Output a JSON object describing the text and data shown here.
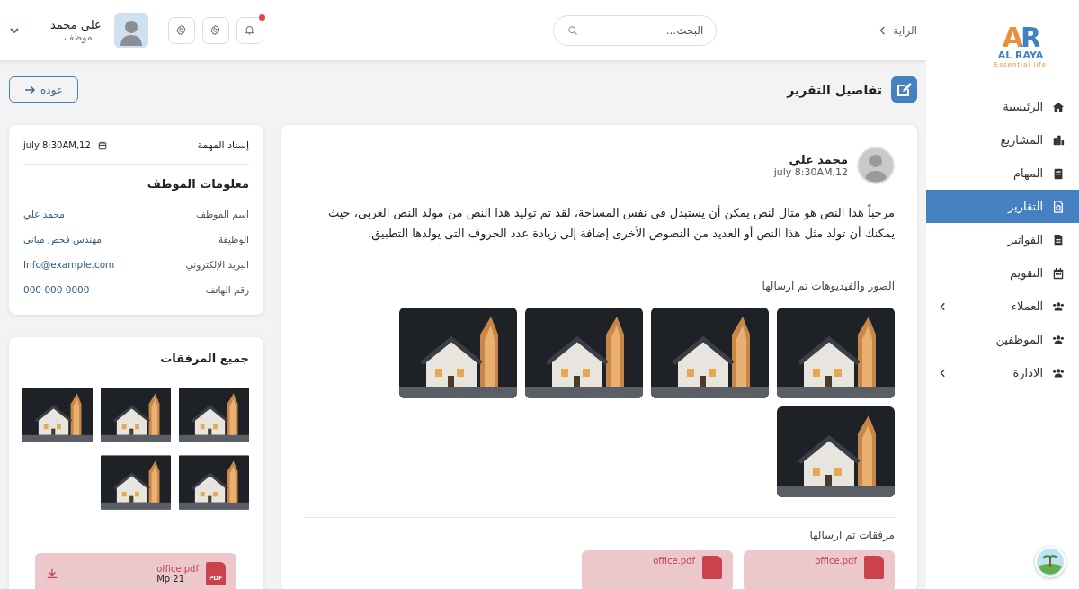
{
  "sidebar": {
    "logo": {
      "mark": "AR",
      "name": "AL RAYA",
      "tagline": "Essential life"
    },
    "items": [
      {
        "label": "الرئيسية",
        "kind": "home",
        "selected": false,
        "has_submenu": false
      },
      {
        "label": "المشاريع",
        "kind": "buildings",
        "selected": false,
        "has_submenu": false
      },
      {
        "label": "المهام",
        "kind": "tasks",
        "selected": false,
        "has_submenu": false
      },
      {
        "label": "التقارير",
        "kind": "report",
        "selected": true,
        "has_submenu": false
      },
      {
        "label": "الفواتير",
        "kind": "invoice",
        "selected": false,
        "has_submenu": false
      },
      {
        "label": "التقويم",
        "kind": "calendar",
        "selected": false,
        "has_submenu": false
      },
      {
        "label": "العملاء",
        "kind": "users",
        "selected": false,
        "has_submenu": true
      },
      {
        "label": "الموظفين",
        "kind": "users",
        "selected": false,
        "has_submenu": false
      },
      {
        "label": "الادارة",
        "kind": "users",
        "selected": false,
        "has_submenu": true
      }
    ]
  },
  "header": {
    "breadcrumb": "الراية",
    "search": {
      "placeholder": "البحث..."
    },
    "notifications_unread": true,
    "user": {
      "name": "علي محمد",
      "role": "موظف"
    }
  },
  "page": {
    "title": "تفاصيل التقرير",
    "back_button": "عوده"
  },
  "report": {
    "author": "محمد علي",
    "time": "july 8:30AM,12",
    "body": "مرحباً هذا النص هو مثال لنص يمكن أن يستبدل في نفس المساحة، لقد تم توليد هذا النص من مولد النص العربى، حيث يمكنك أن تولد مثل هذا النص أو العديد من النصوص الأخرى إضافة إلى زيادة عدد الحروف التى يولدها التطبيق.",
    "media_label": "الصور والفيديوهات تم ارسالها",
    "media": [
      {
        "kind": "image"
      },
      {
        "kind": "image"
      },
      {
        "kind": "image"
      },
      {
        "kind": "image"
      },
      {
        "kind": "image"
      }
    ],
    "attachments_label": "مرفقات تم ارسالها",
    "attachments": [
      {
        "name": "office.pdf"
      },
      {
        "name": "office.pdf"
      }
    ]
  },
  "assignment": {
    "label": "إسناد المهمة",
    "date": "july 8:30AM,12"
  },
  "employee": {
    "title": "معلومات الموظف",
    "fields": [
      {
        "label": "اسم الموظف",
        "value": "محمد علي"
      },
      {
        "label": "الوظيفة",
        "value": "مهندس فحص مباني"
      },
      {
        "label": "البريد الإلكتروني",
        "value": "Info@example.com"
      },
      {
        "label": "رقم الهاتف",
        "value": "000 000 0000"
      }
    ]
  },
  "all_attachments": {
    "title": "جميع المرفقات",
    "images": [
      {
        "kind": "image"
      },
      {
        "kind": "image"
      },
      {
        "kind": "image"
      },
      {
        "kind": "image"
      },
      {
        "kind": "image"
      }
    ],
    "files": [
      {
        "type_label": "PDF",
        "name": "office.pdf",
        "size": "Mp 21"
      }
    ]
  }
}
